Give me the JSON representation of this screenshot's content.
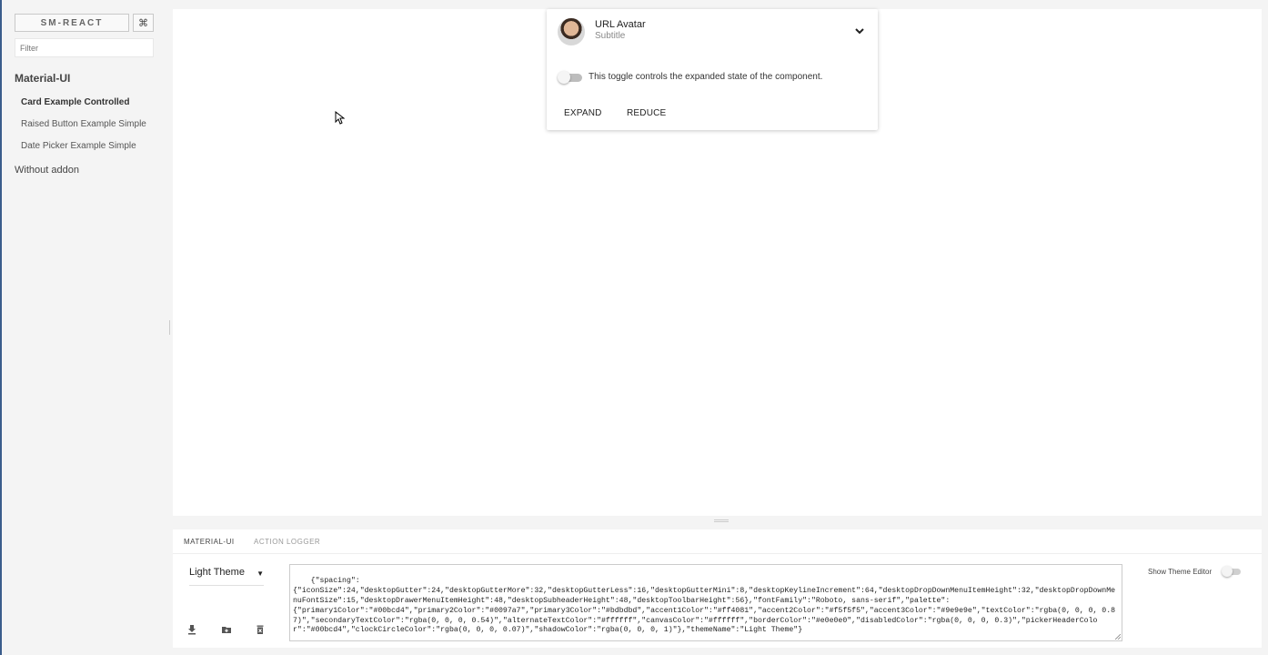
{
  "sidebar": {
    "brand_label": "SM-REACT",
    "shortcuts_icon": "command-icon",
    "filter_placeholder": "Filter",
    "groups": [
      {
        "title": "Material-UI",
        "stories": [
          {
            "label": "Card Example Controlled",
            "selected": true
          },
          {
            "label": "Raised Button Example Simple",
            "selected": false
          },
          {
            "label": "Date Picker Example Simple",
            "selected": false
          }
        ]
      },
      {
        "title": "Without addon",
        "stories": []
      }
    ]
  },
  "card": {
    "title": "URL Avatar",
    "subtitle": "Subtitle",
    "toggle_label": "This toggle controls the expanded state of the component.",
    "toggle_on": false,
    "expand_label": "EXPAND",
    "reduce_label": "REDUCE"
  },
  "addon_panel": {
    "tabs": [
      {
        "label": "MATERIAL-UI",
        "active": true
      },
      {
        "label": "ACTION LOGGER",
        "active": false
      }
    ],
    "theme_select_value": "Light Theme",
    "theme_json": "{\"spacing\":\n{\"iconSize\":24,\"desktopGutter\":24,\"desktopGutterMore\":32,\"desktopGutterLess\":16,\"desktopGutterMini\":8,\"desktopKeylineIncrement\":64,\"desktopDropDownMenuItemHeight\":32,\"desktopDropDownMenuFontSize\":15,\"desktopDrawerMenuItemHeight\":48,\"desktopSubheaderHeight\":48,\"desktopToolbarHeight\":56},\"fontFamily\":\"Roboto, sans-serif\",\"palette\":\n{\"primary1Color\":\"#00bcd4\",\"primary2Color\":\"#0097a7\",\"primary3Color\":\"#bdbdbd\",\"accent1Color\":\"#ff4081\",\"accent2Color\":\"#f5f5f5\",\"accent3Color\":\"#9e9e9e\",\"textColor\":\"rgba(0, 0, 0, 0.87)\",\"secondaryTextColor\":\"rgba(0, 0, 0, 0.54)\",\"alternateTextColor\":\"#ffffff\",\"canvasColor\":\"#ffffff\",\"borderColor\":\"#e0e0e0\",\"disabledColor\":\"rgba(0, 0, 0, 0.3)\",\"pickerHeaderColor\":\"#00bcd4\",\"clockCircleColor\":\"rgba(0, 0, 0, 0.07)\",\"shadowColor\":\"rgba(0, 0, 0, 1)\"},\"themeName\":\"Light Theme\"}",
    "show_editor_label": "Show Theme Editor",
    "show_editor_on": false,
    "tool_icons": [
      "download-icon",
      "open-folder-icon",
      "delete-icon"
    ]
  }
}
